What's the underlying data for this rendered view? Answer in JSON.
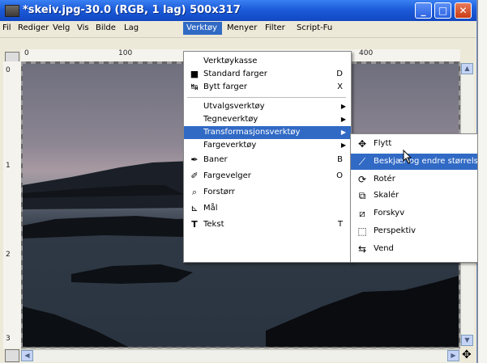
{
  "window": {
    "title": "*skeiv.jpg-30.0 (RGB, 1 lag) 500x317",
    "btn_min": "_",
    "btn_max": "□",
    "btn_close": "✕"
  },
  "menubar": [
    "Fil",
    "Rediger",
    "Velg",
    "Vis",
    "Bilde",
    "Lag",
    "Verktøy",
    "Menyer",
    "Filter",
    "Script-Fu"
  ],
  "ruler": {
    "top": [
      "0",
      "100",
      "400"
    ],
    "left": [
      "0",
      "1",
      "2",
      "3"
    ]
  },
  "tools_menu": [
    {
      "label": "Verktøykasse",
      "shortcut": "",
      "icon": "",
      "submenu": false
    },
    {
      "label": "Standard farger",
      "shortcut": "D",
      "icon": "■",
      "submenu": false
    },
    {
      "label": "Bytt farger",
      "shortcut": "X",
      "icon": "↹",
      "submenu": false
    },
    {
      "label": "Utvalgsverktøy",
      "shortcut": "",
      "icon": "",
      "submenu": true
    },
    {
      "label": "Tegneverktøy",
      "shortcut": "",
      "icon": "",
      "submenu": true
    },
    {
      "label": "Transformasjonsverktøy",
      "shortcut": "",
      "icon": "",
      "submenu": true
    },
    {
      "label": "Fargeverktøy",
      "shortcut": "",
      "icon": "",
      "submenu": true
    },
    {
      "label": "Baner",
      "shortcut": "B",
      "icon": "✒",
      "submenu": false
    },
    {
      "label": "Fargevelger",
      "shortcut": "O",
      "icon": "✐",
      "submenu": false
    },
    {
      "label": "Forstørr",
      "shortcut": "",
      "icon": "⌕",
      "submenu": false
    },
    {
      "label": "Mål",
      "shortcut": "",
      "icon": "⊾",
      "submenu": false
    },
    {
      "label": "Tekst",
      "shortcut": "T",
      "icon": "T",
      "submenu": false
    }
  ],
  "transform_menu": [
    {
      "label": "Flytt",
      "icon": "✥"
    },
    {
      "label": "Beskjær og endre størrelse",
      "icon": "⟋"
    },
    {
      "label": "Rotér",
      "icon": "⟳"
    },
    {
      "label": "Skalér",
      "icon": "⧉"
    },
    {
      "label": "Forskyv",
      "icon": "⧄"
    },
    {
      "label": "Perspektiv",
      "icon": "⬚"
    },
    {
      "label": "Vend",
      "icon": "⇆"
    }
  ],
  "colors": {
    "accent": "#316ac5",
    "titlebar": "#1c5bd9"
  }
}
